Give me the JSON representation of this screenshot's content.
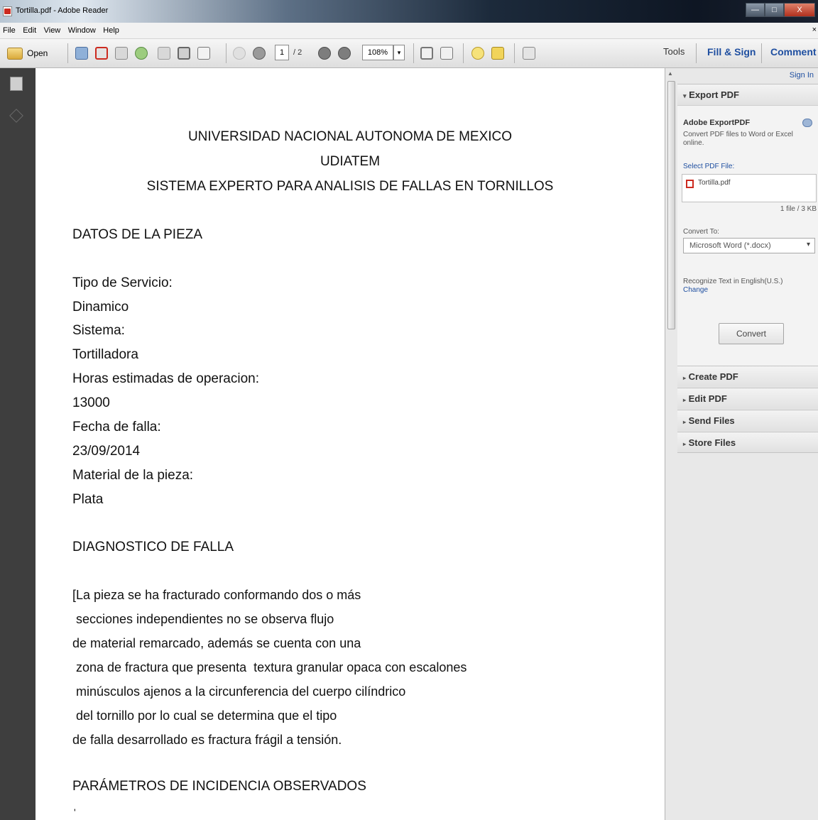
{
  "window": {
    "title": "Tortilla.pdf - Adobe Reader",
    "minimize": "—",
    "maximize": "□",
    "close": "X"
  },
  "menu": [
    "File",
    "Edit",
    "View",
    "Window",
    "Help"
  ],
  "menu_close": "×",
  "toolbar": {
    "open_label": "Open",
    "page_current": "1",
    "page_total": "/ 2",
    "zoom": "108%",
    "tools_label": "Tools",
    "fill_sign_label": "Fill & Sign",
    "comment_label": "Comment"
  },
  "document": {
    "header": [
      "UNIVERSIDAD NACIONAL AUTONOMA DE MEXICO",
      "UDIATEM",
      "SISTEMA EXPERTO PARA ANALISIS DE FALLAS EN TORNILLOS"
    ],
    "section1_title": "DATOS DE LA PIEZA",
    "fields": [
      "Tipo de Servicio:",
      "Dinamico",
      "Sistema:",
      "Tortilladora",
      "Horas estimadas de operacion:",
      "13000",
      "Fecha de falla:",
      "23/09/2014",
      "Material de la pieza:",
      "Plata"
    ],
    "section2_title": "DIAGNOSTICO DE FALLA",
    "diagnosis": [
      "[La pieza se ha fracturado conformando dos o más",
      " secciones independientes no se observa flujo",
      "de material remarcado, además se cuenta con una",
      " zona de fractura que presenta  textura granular opaca con escalones",
      " minúsculos ajenos a la circunferencia del cuerpo cilíndrico",
      " del tornillo por lo cual se determina que el tipo",
      "de falla desarrollado es fractura frágil a tensión."
    ],
    "section3_title": "PARÁMETROS DE INCIDENCIA OBSERVADOS",
    "trailing_mark": "'"
  },
  "panel": {
    "sign_in": "Sign In",
    "export_section": "Export PDF",
    "export_heading": "Adobe ExportPDF",
    "export_desc": "Convert PDF files to Word or Excel online.",
    "select_label": "Select PDF File:",
    "file_name": "Tortilla.pdf",
    "file_count": "1 file / 3 KB",
    "convert_to_label": "Convert To:",
    "convert_option": "Microsoft Word (*.docx)",
    "recognize_text": "Recognize Text in English(U.S.)",
    "change_link": "Change",
    "convert_button": "Convert",
    "sections": [
      "Create PDF",
      "Edit PDF",
      "Send Files",
      "Store Files"
    ]
  },
  "colors": {
    "link": "#1f4fa0",
    "pdf_red": "#cc2a1f",
    "panel_bg": "#e8e8e8",
    "viewer_bg": "#3e3e3e"
  }
}
